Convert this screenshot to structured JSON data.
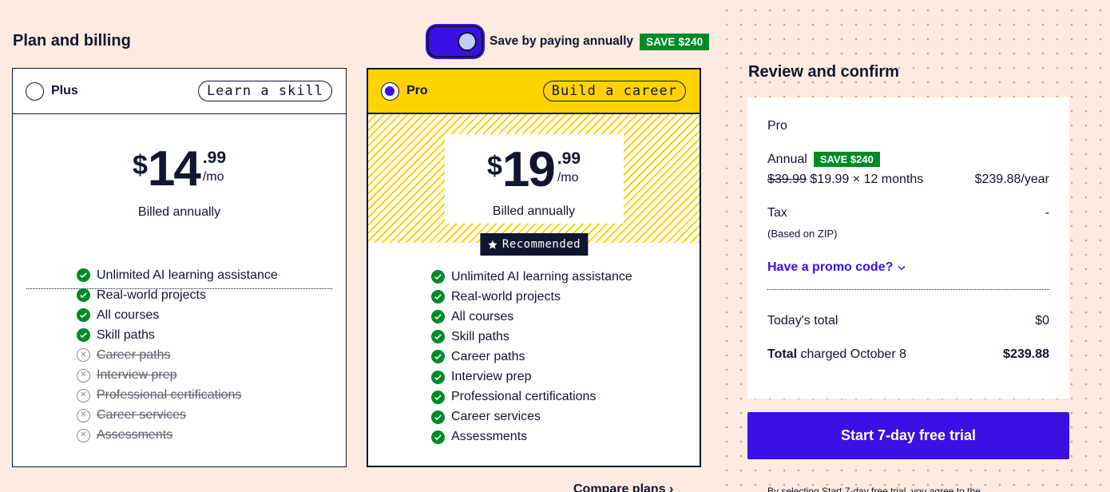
{
  "page": {
    "plan_heading": "Plan and billing",
    "review_heading": "Review and confirm"
  },
  "toggle": {
    "label": "Save by paying annually",
    "badge": "SAVE $240",
    "on": true
  },
  "plans": [
    {
      "name": "Plus",
      "tag": "Learn a skill",
      "currency": "$",
      "dollars": "14",
      "cents": ".99",
      "period": "/mo",
      "billed": "Billed annually",
      "selected": false,
      "features": [
        {
          "label": "Unlimited AI learning assistance",
          "included": true
        },
        {
          "label": "Real-world projects",
          "included": true
        },
        {
          "label": "All courses",
          "included": true
        },
        {
          "label": "Skill paths",
          "included": true
        },
        {
          "label": "Career paths",
          "included": false
        },
        {
          "label": "Interview prep",
          "included": false
        },
        {
          "label": "Professional certifications",
          "included": false
        },
        {
          "label": "Career services",
          "included": false
        },
        {
          "label": "Assessments",
          "included": false
        }
      ]
    },
    {
      "name": "Pro",
      "tag": "Build a career",
      "currency": "$",
      "dollars": "19",
      "cents": ".99",
      "period": "/mo",
      "billed": "Billed annually",
      "recommended": "Recommended",
      "selected": true,
      "features": [
        {
          "label": "Unlimited AI learning assistance",
          "included": true
        },
        {
          "label": "Real-world projects",
          "included": true
        },
        {
          "label": "All courses",
          "included": true
        },
        {
          "label": "Skill paths",
          "included": true
        },
        {
          "label": "Career paths",
          "included": true
        },
        {
          "label": "Interview prep",
          "included": true
        },
        {
          "label": "Professional certifications",
          "included": true
        },
        {
          "label": "Career services",
          "included": true
        },
        {
          "label": "Assessments",
          "included": true
        }
      ]
    }
  ],
  "compare_link": "Compare plans",
  "summary": {
    "plan": "Pro",
    "billing_label": "Annual",
    "billing_badge": "SAVE $240",
    "old_price": "$39.99",
    "price_detail": "$19.99 × 12 months",
    "yearly_total": "$239.88/year",
    "tax_label": "Tax",
    "tax_note": "(Based on ZIP)",
    "tax_value": "-",
    "promo_label": "Have a promo code?",
    "today_label": "Today's total",
    "today_value": "$0",
    "total_bold": "Total",
    "total_label": " charged October 8",
    "total_value": "$239.88"
  },
  "cta_label": "Start 7-day free trial",
  "fine_print": "By selecting Start 7-day free trial, you agree to the",
  "colors": {
    "background": "#fdebe1",
    "accent": "#3a10e5",
    "pro_yellow": "#ffd300",
    "save_green": "#008a27",
    "ink": "#10162f"
  }
}
